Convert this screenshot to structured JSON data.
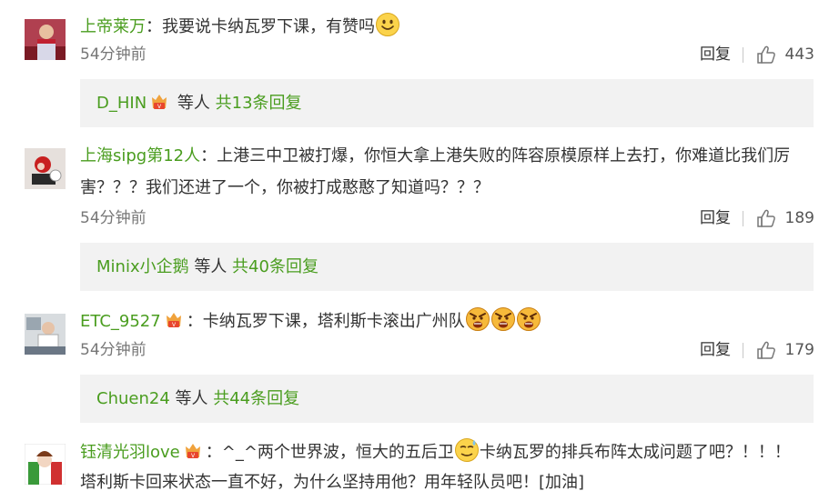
{
  "comments": [
    {
      "username": "上帝莱万",
      "text_line1": "：我要说卡纳瓦罗下课，有赞吗",
      "text_line2": "",
      "time": "54分钟前",
      "reply_label": "回复",
      "likes": "443",
      "sub_user": "D_HIN",
      "sub_mid": " 等人 ",
      "sub_count": "共13条回复"
    },
    {
      "username": "上海sipg第12人",
      "text_line1": "：上港三中卫被打爆，你恒大拿上港失败的阵容原模原样上去打，你难道比我们厉",
      "text_line2": "害？？？我们还进了一个，你被打成憨憨了知道吗？？？",
      "time": "54分钟前",
      "reply_label": "回复",
      "likes": "189",
      "sub_user": "Minix小企鹅",
      "sub_mid": " 等人 ",
      "sub_count": "共40条回复"
    },
    {
      "username": "ETC_9527",
      "text_line1": "：卡纳瓦罗下课，塔利斯卡滚出广州队",
      "text_line2": "",
      "time": "54分钟前",
      "reply_label": "回复",
      "likes": "179",
      "sub_user": "Chuen24",
      "sub_mid": " 等人 ",
      "sub_count": "共44条回复"
    },
    {
      "username": "钰清光羽love",
      "text_line1a": "：^_^两个世界波，恒大的五后卫",
      "text_line1b": "卡纳瓦罗的排兵布阵太成问题了吧？！！！",
      "text_line2": "塔利斯卡回来状态一直不好，为什么坚持用他？用年轻队员吧！[加油]"
    }
  ],
  "colors": {
    "username": "#4a9d1f",
    "text": "#333333",
    "meta": "#777777",
    "subbox_bg": "#f2f2f2"
  },
  "icons": {
    "like": "thumbs-up-icon",
    "badge": "member-badge-icon",
    "emoji_smile": "smile-emoji",
    "emoji_angry": "angry-emoji",
    "emoji_sweat": "sweat-emoji"
  }
}
